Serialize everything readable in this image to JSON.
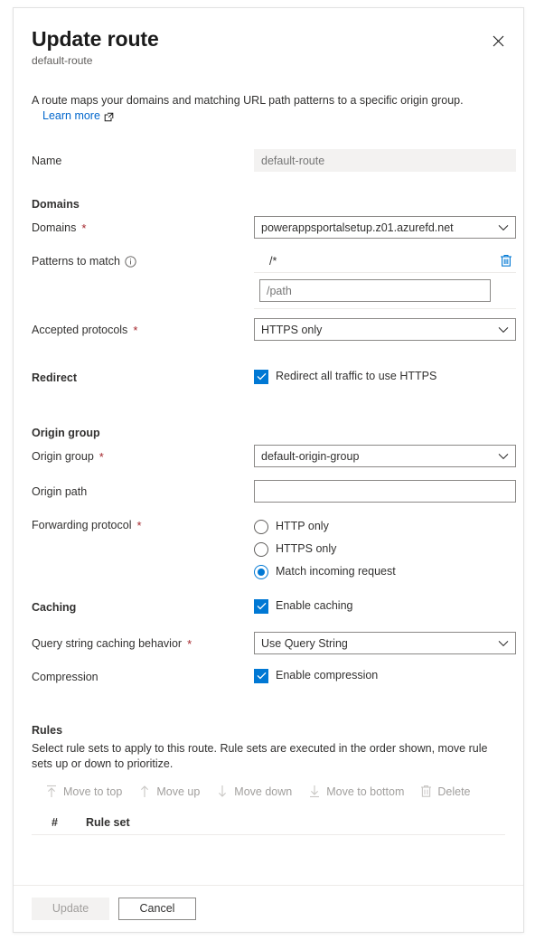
{
  "dialog": {
    "title": "Update route",
    "subtitle": "default-route",
    "close_label": "Close",
    "description": "A route maps your domains and matching URL path patterns to a specific origin group.",
    "learn_more": "Learn more"
  },
  "fields": {
    "name_label": "Name",
    "name_value": "default-route"
  },
  "domains": {
    "section_label": "Domains",
    "domains_label": "Domains",
    "domains_value": "powerappsportalsetup.z01.azurefd.net",
    "patterns_label": "Patterns to match",
    "pattern_items": [
      "/*"
    ],
    "pattern_placeholder": "/path",
    "pattern_input_value": "",
    "accepted_protocols_label": "Accepted protocols",
    "accepted_protocols_value": "HTTPS only"
  },
  "redirect": {
    "label": "Redirect",
    "checkbox_label": "Redirect all traffic to use HTTPS",
    "checked": true
  },
  "origin_group": {
    "section_label": "Origin group",
    "origin_group_label": "Origin group",
    "origin_group_value": "default-origin-group",
    "origin_path_label": "Origin path",
    "origin_path_value": "",
    "origin_path_placeholder": "",
    "forwarding_protocol_label": "Forwarding protocol",
    "forwarding_options": [
      {
        "label": "HTTP only",
        "selected": false
      },
      {
        "label": "HTTPS only",
        "selected": false
      },
      {
        "label": "Match incoming request",
        "selected": true
      }
    ]
  },
  "caching": {
    "label": "Caching",
    "enable_label": "Enable caching",
    "enabled": true,
    "query_string_label": "Query string caching behavior",
    "query_string_value": "Use Query String",
    "compression_label": "Compression",
    "compression_enable_label": "Enable compression",
    "compression_enabled": true
  },
  "rules": {
    "section_label": "Rules",
    "description": "Select rule sets to apply to this route. Rule sets are executed in the order shown, move rule sets up or down to prioritize.",
    "commands": [
      {
        "label": "Move to top",
        "icon": "move-to-top-icon",
        "disabled": true
      },
      {
        "label": "Move up",
        "icon": "move-up-icon",
        "disabled": true
      },
      {
        "label": "Move down",
        "icon": "move-down-icon",
        "disabled": true
      },
      {
        "label": "Move to bottom",
        "icon": "move-to-bottom-icon",
        "disabled": true
      },
      {
        "label": "Delete",
        "icon": "trash-icon",
        "disabled": true
      }
    ],
    "columns": [
      "#",
      "Rule set"
    ],
    "rows": []
  },
  "footer": {
    "update_label": "Update",
    "update_disabled": true,
    "cancel_label": "Cancel"
  },
  "colors": {
    "accent": "#0078d4",
    "link": "#0066cc",
    "required": "#a4262c",
    "disabled_text": "#a19f9d",
    "border": "#8a8886"
  }
}
